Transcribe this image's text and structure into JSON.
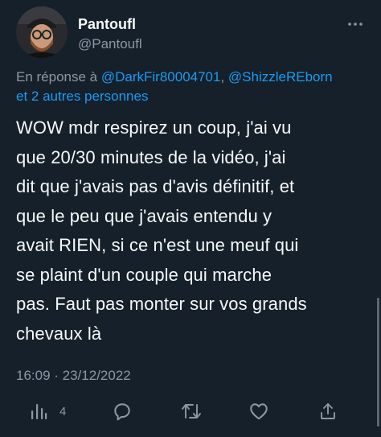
{
  "author": {
    "display_name": "Pantoufl",
    "handle": "@Pantoufl"
  },
  "reply_context": {
    "prefix": "En réponse à ",
    "mention_1": "@DarkFir80004701",
    "separator": ", ",
    "mention_2": "@ShizzleREborn",
    "others": "et 2 autres personnes"
  },
  "tweet": {
    "lines": [
      "WOW mdr respirez un coup, j'ai vu",
      "que 20/30 minutes de la vidéo, j'ai",
      "dit que j'avais pas d'avis définitif, et",
      "que le peu que j'avais entendu y",
      "avait RIEN, si ce n'est une meuf qui",
      "se plaint d'un couple qui marche",
      "pas. Faut pas monter sur vos grands",
      "chevaux là"
    ]
  },
  "timestamp": "16:09 · 23/12/2022",
  "actions": {
    "views_count": "4",
    "icons": [
      "views-icon",
      "reply-icon",
      "retweet-icon",
      "like-icon",
      "share-icon"
    ]
  },
  "colors": {
    "background": "#15202b",
    "text": "#f7f9f9",
    "secondary": "#8b98a5",
    "link": "#1d9bf0"
  }
}
